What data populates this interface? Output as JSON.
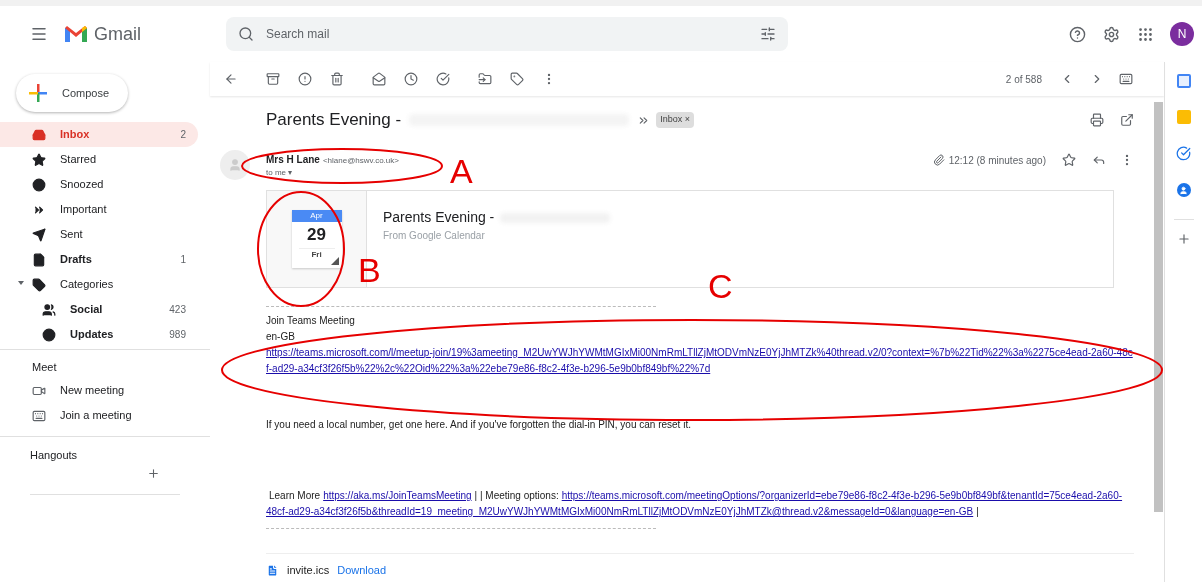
{
  "header": {
    "app_name": "Gmail",
    "search": {
      "placeholder": "Search mail"
    },
    "avatar": "N"
  },
  "compose": "Compose",
  "nav": [
    {
      "label": "Inbox",
      "count": "2",
      "selected": true,
      "bold": true
    },
    {
      "label": "Starred",
      "selected": false,
      "bold": false
    },
    {
      "label": "Snoozed",
      "selected": false,
      "bold": false
    },
    {
      "label": "Important",
      "selected": false,
      "bold": false
    },
    {
      "label": "Sent",
      "selected": false,
      "bold": false
    },
    {
      "label": "Drafts",
      "count": "1",
      "selected": false,
      "bold": true
    },
    {
      "label": "Categories",
      "selected": false,
      "bold": false,
      "expanded": true,
      "children": [
        {
          "label": "Social",
          "count": "423",
          "selected": false,
          "bold": true
        },
        {
          "label": "Updates",
          "count": "989",
          "selected": false,
          "bold": true
        }
      ]
    }
  ],
  "meet": {
    "title": "Meet",
    "items": [
      "New meeting",
      "Join a meeting"
    ]
  },
  "hangouts": {
    "title": "Hangouts"
  },
  "toolbar": {
    "pager": "2 of 588"
  },
  "email": {
    "subject": "Parents Evening -",
    "label": {
      "text": "Inbox",
      "close": "×"
    },
    "sender": "Mrs H Lane",
    "address": "<hlane@hswv.co.uk>",
    "to": "to me",
    "to_caret": "▾",
    "time": "12:12 (8 minutes ago)",
    "event": {
      "month": "Apr",
      "day": "29",
      "weekday": "Fri",
      "title": "Parents Evening -",
      "source": "From Google Calendar"
    },
    "body": [
      [
        {
          "kind": "text",
          "text": "Join Teams Meeting"
        },
        {
          "kind": "text",
          "text": "en-GB"
        },
        {
          "kind": "link",
          "text": "https://teams.microsoft.com/l/meetup-join/19%3ameeting_M2UwYWJhYWMtMGIxMi00NmRmLTllZjMtODVmNzE0YjJhMTZk%40thread.v2/0?context=%7b%22Tid%22%3a%2275ce4ead-2a60-48cf-ad29-a34cf3f26f5b%22%2c%22Oid%22%3a%22ebe79e86-f8c2-4f3e-b296-5e9b0bf849bf%22%7d"
        }
      ],
      [
        {
          "kind": "text",
          "text": "If you need a local number, get one here. And if you've forgotten the dial-in PIN, you can reset it."
        }
      ],
      [
        {
          "kind": "mixed",
          "parts": [
            {
              "kind": "text",
              "text": "Learn More"
            },
            {
              "kind": "link",
              "text": "https://aka.ms/JoinTeamsMeeting"
            },
            {
              "kind": "text",
              "text": "|  | Meeting options:"
            },
            {
              "kind": "link",
              "text": "https://teams.microsoft.com/meetingOptions/?organizerId=ebe79e86-f8c2-4f3e-b296-5e9b0bf849bf&tenantId=75ce4ead-2a60-"
            }
          ]
        },
        {
          "kind": "mixed",
          "parts": [
            {
              "kind": "link",
              "text": "48cf-ad29-a34cf3f26f5b&threadId=19_meeting_M2UwYWJhYWMtMGIxMi00NmRmLTllZjMtODVmNzE0YjJhMTZk@thread.v2&messageId=0&language=en-GB"
            },
            {
              "kind": "text",
              "text": "|"
            }
          ]
        }
      ]
    ],
    "attachment": {
      "name": "invite.ics",
      "action": "Download"
    }
  },
  "annotations": [
    {
      "letter": "A"
    },
    {
      "letter": "B"
    },
    {
      "letter": "C"
    }
  ]
}
